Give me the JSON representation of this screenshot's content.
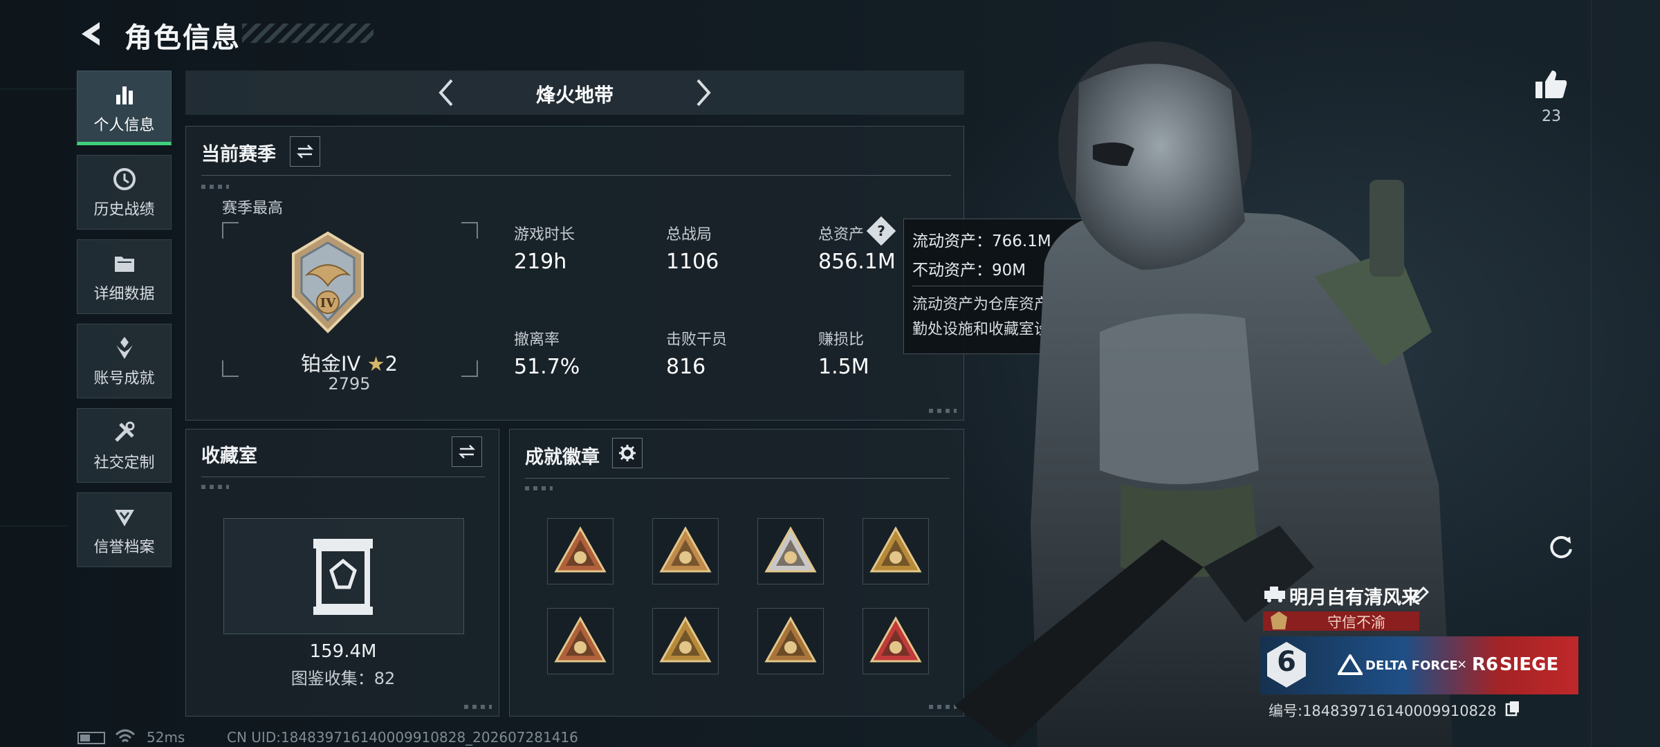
{
  "header": {
    "title": "角色信息"
  },
  "sidebar": {
    "items": [
      {
        "label": "个人信息",
        "icon": "bar-chart-icon",
        "active": true
      },
      {
        "label": "历史战绩",
        "icon": "history-icon"
      },
      {
        "label": "详细数据",
        "icon": "folder-icon"
      },
      {
        "label": "账号成就",
        "icon": "achievement-icon"
      },
      {
        "label": "社交定制",
        "icon": "tools-icon"
      },
      {
        "label": "信誉档案",
        "icon": "shield-icon"
      }
    ]
  },
  "mode": {
    "name": "烽火地带"
  },
  "season": {
    "title": "当前赛季",
    "best_label": "赛季最高",
    "rank": "铂金IV",
    "stars": "2",
    "score": "2795",
    "rank_roman": "IV",
    "stats": [
      {
        "label": "游戏时长",
        "value": "219h"
      },
      {
        "label": "总战局",
        "value": "1106"
      },
      {
        "label": "总资产",
        "value": "856.1M"
      },
      {
        "label": "撤离率",
        "value": "51.7%"
      },
      {
        "label": "击败干员",
        "value": "816"
      },
      {
        "label": "赚损比",
        "value": "1.5M"
      }
    ]
  },
  "tooltip": {
    "liquid": "流动资产：766.1M",
    "fixed": "不动资产：90M",
    "desc": "流动资产为仓库资产和哈夫币，不动资产为特勤处设施和收藏室设施"
  },
  "collection": {
    "title": "收藏室",
    "value": "159.4M",
    "count_text": "图鉴收集：82"
  },
  "achievements": {
    "title": "成就徽章",
    "badges": [
      "sb-badge-icon",
      "sb-plane-badge-icon",
      "eagle-badge-icon",
      "soldier-badge-icon",
      "helmet-badge-icon",
      "canister-badge-icon",
      "squad-badge-icon",
      "star-shield-badge-icon"
    ]
  },
  "likes": {
    "count": "23"
  },
  "player": {
    "name": "明月自有清风来",
    "honor": "守信不渝",
    "banner_left": "6",
    "banner_df": "DELTA FORCE",
    "banner_x": "×",
    "banner_r6": "R6",
    "banner_siege": "SIEGE",
    "id_text": "编号:1848397161400099108​28"
  },
  "status": {
    "ping": "52ms",
    "uid": "CN UID:1848397161400099108​28_202607281416"
  },
  "colors": {
    "accent_green": "#3fd07a",
    "gold": "#c8a060",
    "honor_red": "#8b1e1e",
    "banner_red": "#c0282a"
  }
}
